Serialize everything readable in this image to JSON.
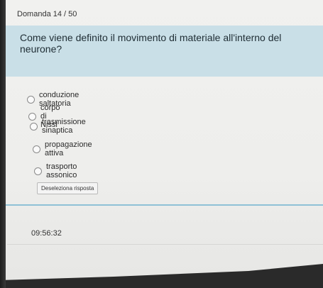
{
  "header": {
    "question_number": "Domanda 14 / 50"
  },
  "question": {
    "text": "Come viene definito il movimento di materiale all'interno del neurone?"
  },
  "options": [
    {
      "label": "conduzione saltatoria"
    },
    {
      "label": "corpo di Nissl"
    },
    {
      "label": "trasmissione sinaptica"
    },
    {
      "label": "propagazione attiva"
    },
    {
      "label": "trasporto assonico"
    }
  ],
  "actions": {
    "clear_label": "Deseleziona risposta"
  },
  "footer": {
    "timer": "09:56:32"
  },
  "colors": {
    "question_band": "#c9dfe7",
    "accent_line": "#8fc1d6"
  }
}
